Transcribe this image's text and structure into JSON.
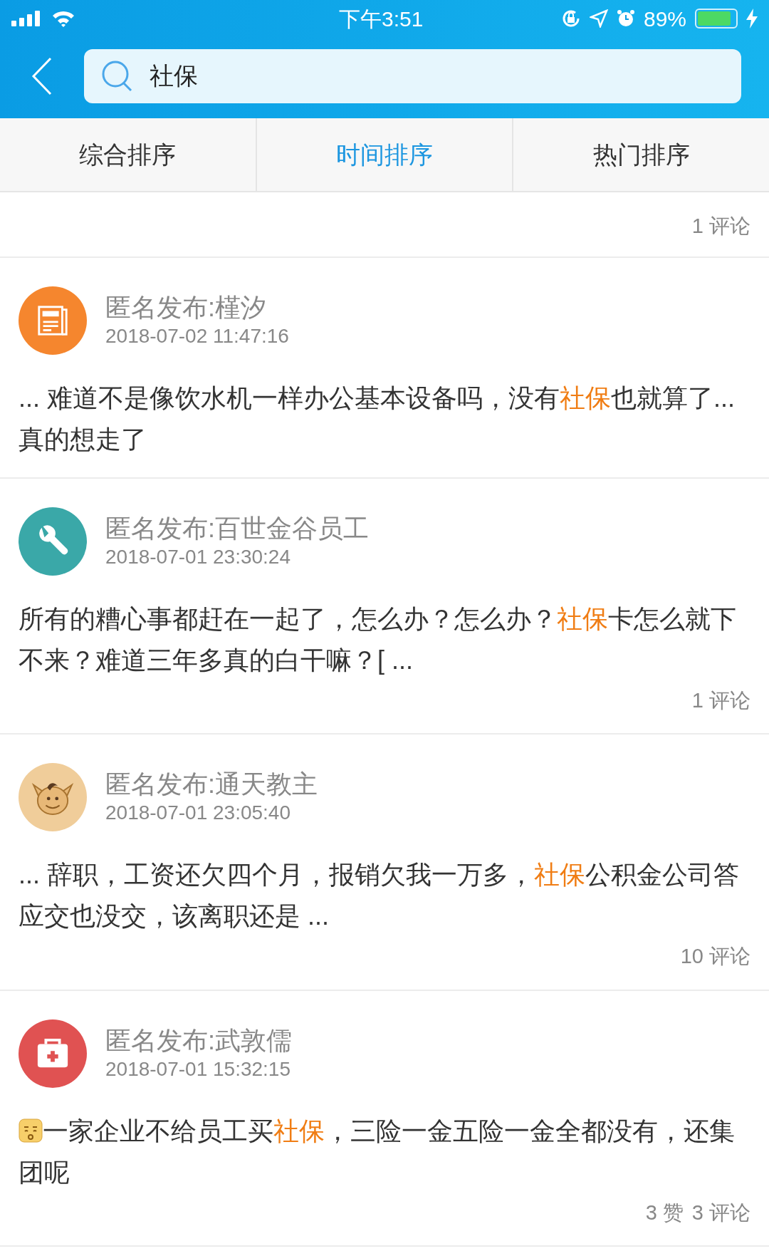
{
  "status_bar": {
    "time": "下午3:51",
    "battery": "89%"
  },
  "search": {
    "value": "社保"
  },
  "sort_tabs": [
    {
      "label": "综合排序",
      "selected": false
    },
    {
      "label": "时间排序",
      "selected": true
    },
    {
      "label": "热门排序",
      "selected": false
    }
  ],
  "posts": [
    {
      "stats": [
        "1 评论"
      ]
    },
    {
      "kind": "news",
      "color": "#f5862e",
      "author": "匿名发布:槿汐",
      "time": "2018-07-02 11:47:16",
      "parts": [
        {
          "kind": "text",
          "text": "... 难道不是像饮水机一样办公基本设备吗，没有"
        },
        {
          "kind": "highlight",
          "text": "社保"
        },
        {
          "kind": "text",
          "text": "也就算了...真的想走了"
        }
      ]
    },
    {
      "kind": "wrench",
      "color": "#3aa8a8",
      "author": "匿名发布:百世金谷员工",
      "time": "2018-07-01 23:30:24",
      "parts": [
        {
          "kind": "text",
          "text": "所有的糟心事都赶在一起了，怎么办？怎么办？"
        },
        {
          "kind": "highlight",
          "text": "社保"
        },
        {
          "kind": "text",
          "text": "卡怎么就下不来？难道三年多真的白干嘛？[ ..."
        }
      ],
      "stats": [
        "1 评论"
      ]
    },
    {
      "kind": "donkey",
      "color": "#f0cd9a",
      "author": "匿名发布:通天教主",
      "time": "2018-07-01 23:05:40",
      "parts": [
        {
          "kind": "text",
          "text": "... 辞职，工资还欠四个月，报销欠我一万多，"
        },
        {
          "kind": "highlight",
          "text": "社保"
        },
        {
          "kind": "text",
          "text": "公积金公司答应交也没交，该离职还是 ..."
        }
      ],
      "stats": [
        "10 评论"
      ]
    },
    {
      "kind": "medkit",
      "color": "#e05252",
      "author": "匿名发布:武敦儒",
      "time": "2018-07-01 15:32:15",
      "parts": [
        {
          "kind": "emoji"
        },
        {
          "kind": "text",
          "text": "一家企业不给员工买"
        },
        {
          "kind": "highlight",
          "text": "社保"
        },
        {
          "kind": "text",
          "text": "，三险一金五险一金全都没有，还集团呢"
        }
      ],
      "stats": [
        "3 赞",
        "3 评论"
      ]
    }
  ]
}
